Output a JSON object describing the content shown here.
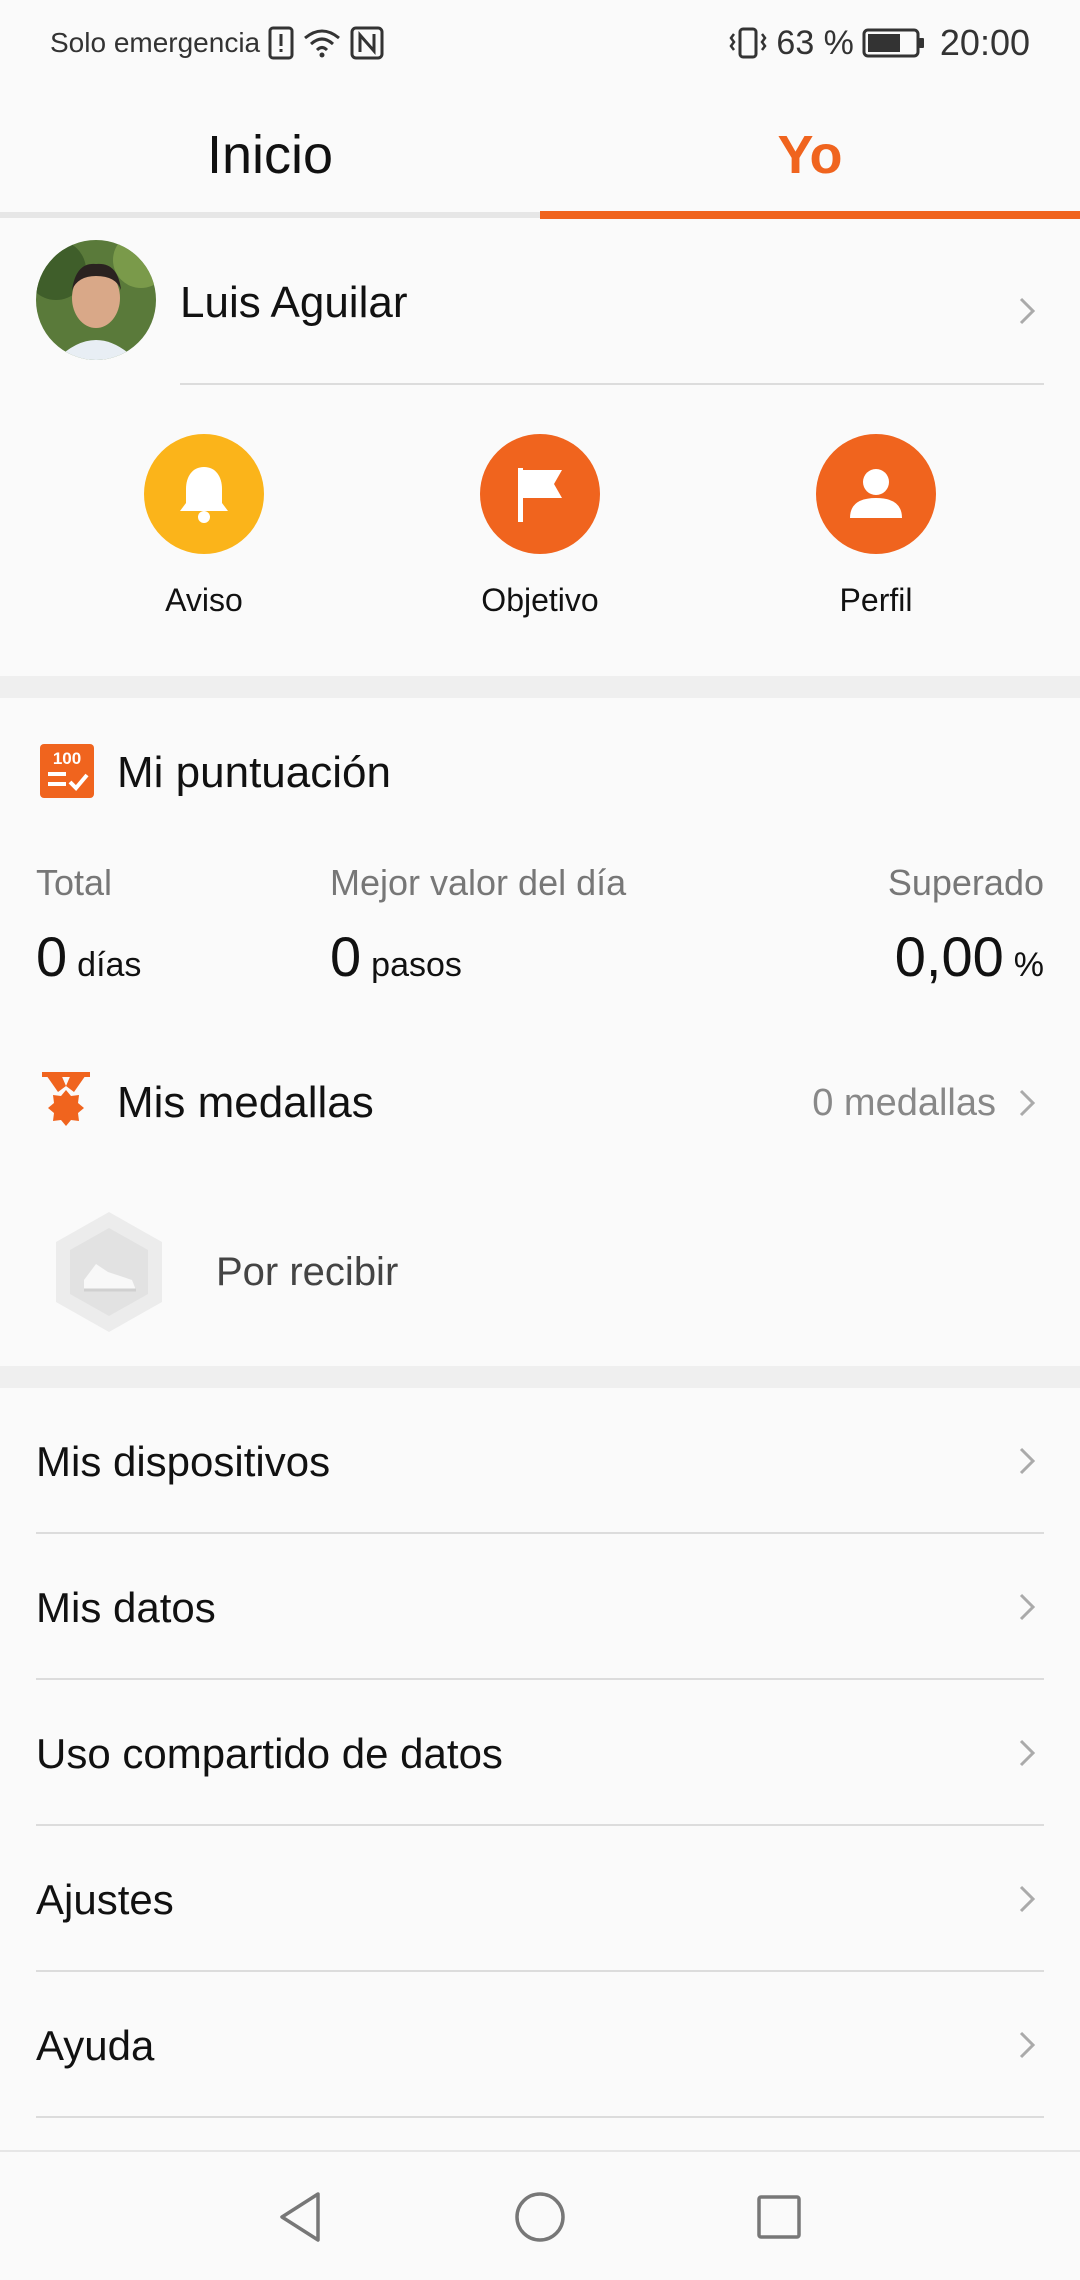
{
  "status_bar": {
    "carrier": "Solo emergencia",
    "battery": "63 %",
    "time": "20:00"
  },
  "tabs": [
    {
      "label": "Inicio",
      "active": false
    },
    {
      "label": "Yo",
      "active": true
    }
  ],
  "colors": {
    "accent": "#f0641e",
    "aviso": "#fbb41a"
  },
  "profile": {
    "name": "Luis Aguilar"
  },
  "quick_actions": [
    {
      "label": "Aviso",
      "icon": "bell-icon"
    },
    {
      "label": "Objetivo",
      "icon": "flag-icon"
    },
    {
      "label": "Perfil",
      "icon": "person-icon"
    }
  ],
  "score": {
    "title": "Mi puntuación",
    "total_label": "Total",
    "total_value": "0",
    "total_unit": "días",
    "best_label": "Mejor valor del día",
    "best_value": "0",
    "best_unit": "pasos",
    "exceeded_label": "Superado",
    "exceeded_value": "0,00",
    "exceeded_unit": "%"
  },
  "medals": {
    "title": "Mis medallas",
    "count": "0 medallas",
    "pending_label": "Por recibir"
  },
  "menu": [
    {
      "label": "Mis dispositivos"
    },
    {
      "label": "Mis datos"
    },
    {
      "label": "Uso compartido de datos"
    },
    {
      "label": "Ajustes"
    },
    {
      "label": "Ayuda"
    }
  ]
}
